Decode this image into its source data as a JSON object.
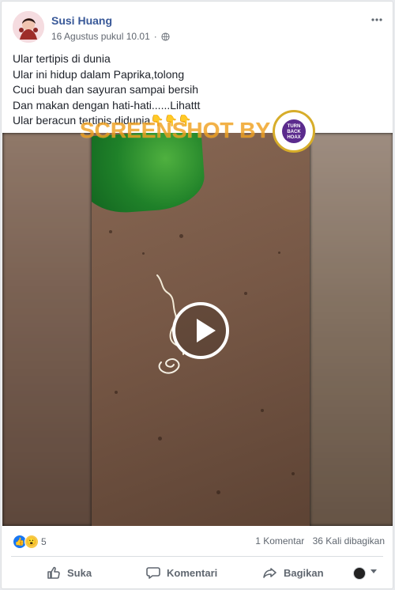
{
  "post": {
    "author": "Susi Huang",
    "date": "16 Agustus pukul 10.01",
    "text": [
      "Ular tertipis di dunia",
      "Ular ini hidup dalam Paprika,tolong",
      "Cuci buah dan sayuran sampai bersih",
      "Dan makan dengan hati-hati......Lihattt",
      "Ular beracun tertipis didunia"
    ],
    "text_emojis": "👇👇👇",
    "watermark": "SCREENSHOT BY",
    "stamp_text": [
      "TURN",
      "BACK",
      "HOAX"
    ]
  },
  "stats": {
    "reaction_count": "5",
    "comments": "1 Komentar",
    "shares": "36 Kali dibagikan"
  },
  "actions": {
    "like": "Suka",
    "comment": "Komentari",
    "share": "Bagikan"
  },
  "icons": {
    "more": "more-horizontal-icon",
    "privacy": "globe-icon",
    "like": "thumb-up-icon",
    "comment": "comment-icon",
    "share": "share-icon",
    "play": "play-icon",
    "reaction_like": "like-reaction-icon",
    "reaction_wow": "wow-reaction-icon"
  },
  "colors": {
    "facebook_blue": "#385898",
    "meta_gray": "#616770",
    "like_blue": "#1877f2",
    "watermark_orange": "#f0a020"
  }
}
